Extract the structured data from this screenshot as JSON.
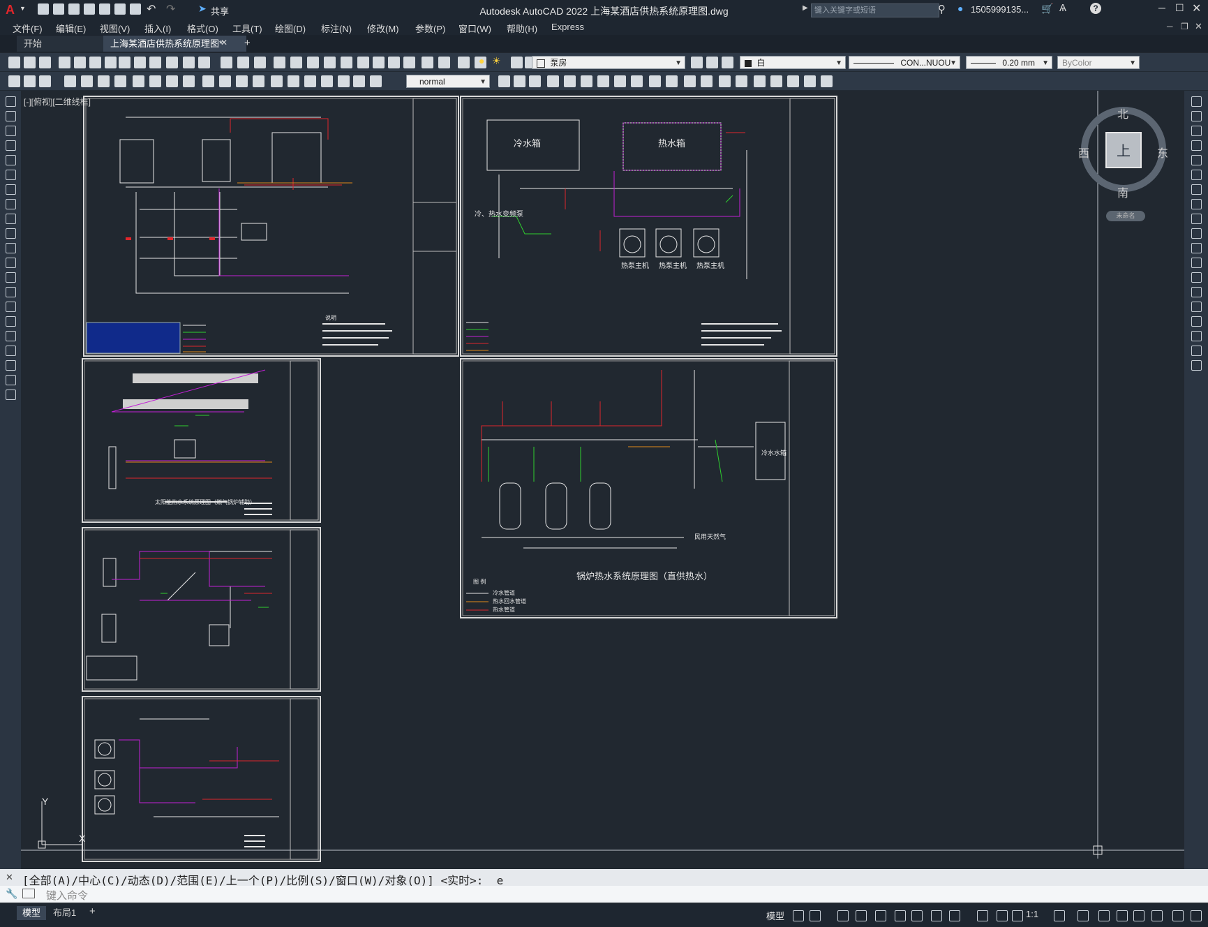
{
  "app": {
    "title": "Autodesk AutoCAD 2022    上海某酒店供热系统原理图.dwg",
    "search_placeholder": "键入关键字或短语",
    "user": "1505999135...",
    "share_label": "共享"
  },
  "menu": [
    "文件(F)",
    "编辑(E)",
    "视图(V)",
    "插入(I)",
    "格式(O)",
    "工具(T)",
    "绘图(D)",
    "标注(N)",
    "修改(M)",
    "参数(P)",
    "窗口(W)",
    "帮助(H)",
    "Express"
  ],
  "tabs": {
    "start": "开始",
    "file": "上海某酒店供热系统原理图*",
    "add": "+"
  },
  "toolbar": {
    "layer": "泵房",
    "color": "白",
    "linetype": "CON...NUOU",
    "lineweight": "0.20 mm",
    "plotstyle": "ByColor",
    "textstyle": "normal"
  },
  "viewport_label": "[-][俯视][二维线框]",
  "viewcube": {
    "north": "北",
    "south": "南",
    "east": "东",
    "west": "西",
    "top": "上",
    "ucs": "未命名"
  },
  "ucs": {
    "x": "X",
    "y": "Y"
  },
  "drawings": {
    "title_boiler": "锅炉热水系统原理图（直供热水）",
    "cold_tank": "冷水箱",
    "hot_tank": "热水箱",
    "pump_label": "冷、热水变频泵",
    "heat_pump": [
      "热泵主机",
      "热泵主机",
      "热泵主机"
    ],
    "boiler_legend": [
      "冷水管道",
      "热水回水管道",
      "热水管道"
    ],
    "cold_water_tank_small": "冷水水箱",
    "solar_title": "太阳能热水系统原理图（燃气锅炉辅助）",
    "gas_label": "民用天然气",
    "legend_title": "图    例",
    "notes_title": "说明"
  },
  "command": {
    "history": "[全部(A)/中心(C)/动态(D)/范围(E)/上一个(P)/比例(S)/窗口(W)/对象(O)] <实时>: _e",
    "placeholder": "键入命令"
  },
  "status": {
    "model_tab": "模型",
    "layout_tab": "布局1",
    "add": "+",
    "model_btn": "模型",
    "scale": "1:1"
  },
  "colors": {
    "accent": "#0a84ff",
    "red": "#e0262b",
    "magenta": "#c21fd6",
    "green": "#2ecf2e",
    "orange": "#e18a1a",
    "white": "#e6e6e6"
  }
}
